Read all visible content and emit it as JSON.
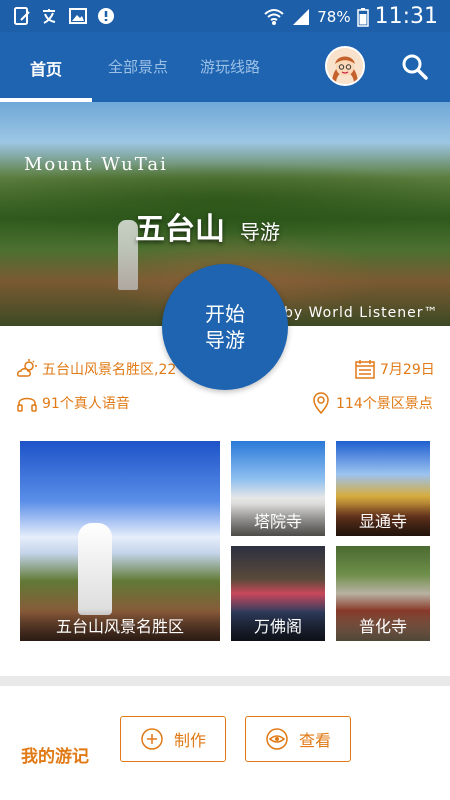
{
  "status": {
    "battery": "78%",
    "time": "11:31"
  },
  "tabs": [
    {
      "label": "首页",
      "active": true
    },
    {
      "label": "全部景点",
      "active": false
    },
    {
      "label": "游玩线路",
      "active": false
    }
  ],
  "hero": {
    "title_en": "Mount WuTai",
    "title_cn": "五台山",
    "title_cn_suffix": "导游",
    "credit": "by World Listener™"
  },
  "start_button": {
    "line1": "开始",
    "line2": "导游"
  },
  "info": {
    "weather": "五台山风景名胜区,22",
    "date": "7月29日",
    "voices": "91个真人语音",
    "spots": "114个景区景点"
  },
  "tiles": [
    {
      "label": "五台山风景名胜区"
    },
    {
      "label": "塔院寺"
    },
    {
      "label": "显通寺"
    },
    {
      "label": "万佛阁"
    },
    {
      "label": "普化寺"
    }
  ],
  "notes": {
    "title": "我的游记",
    "create_label": "制作",
    "view_label": "查看"
  },
  "colors": {
    "primary": "#1e64b0",
    "accent": "#e07a16"
  }
}
